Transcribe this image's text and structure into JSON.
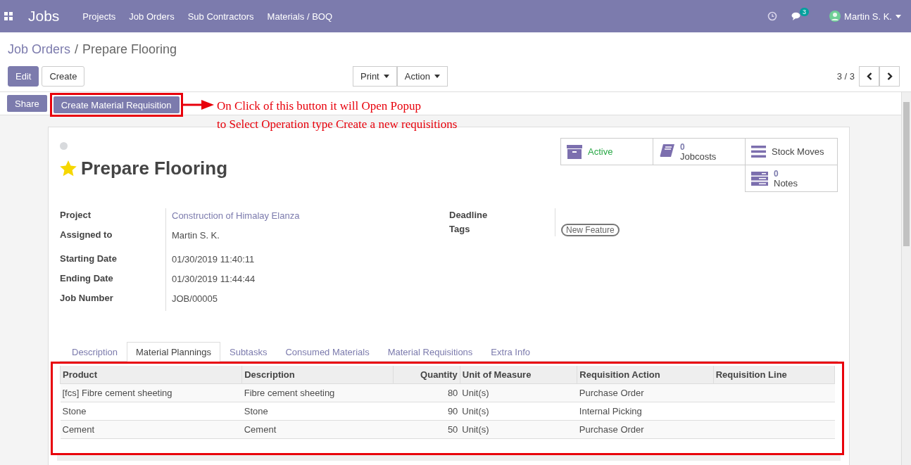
{
  "navbar": {
    "app_title": "Jobs",
    "menu": [
      "Projects",
      "Job Orders",
      "Sub Contractors",
      "Materials / BOQ"
    ],
    "chat_count": "3",
    "user": "Martin S. K."
  },
  "breadcrumb_separator": "/",
  "breadcrumb": [
    {
      "label": "Job Orders",
      "kind": "link"
    },
    {
      "label": "Prepare Flooring",
      "kind": "current"
    }
  ],
  "actions": {
    "primary": "Edit",
    "secondary": "Create",
    "dropdowns": [
      "Print",
      "Action"
    ],
    "pager": "3 / 3"
  },
  "header_buttons": [
    {
      "label": "Share",
      "highlighted": false
    },
    {
      "label": "Create Material Requisition",
      "highlighted": true
    }
  ],
  "annotation": {
    "lines": [
      "On Click of this button it will Open Popup",
      "to Select Operation type Create a new requisitions"
    ]
  },
  "record": {
    "starred": true,
    "title": "Prepare Flooring",
    "smart_buttons": [
      {
        "kind": "archive",
        "label": "Active"
      },
      {
        "kind": "book",
        "count": "0",
        "label": "Jobcosts"
      },
      {
        "kind": "list",
        "label": "Stock Moves"
      },
      {
        "kind": "notes",
        "count": "0",
        "label": "Notes"
      }
    ],
    "left_fields": [
      {
        "label": "Project",
        "value": "Construction of Himalay Elanza",
        "kind": "link"
      },
      {
        "label": "Assigned to",
        "value": "Martin S. K.",
        "kind": "text"
      },
      {
        "label": "Starting Date",
        "value": "01/30/2019 11:40:11",
        "kind": "text"
      },
      {
        "label": "Ending Date",
        "value": "01/30/2019 11:44:44",
        "kind": "text"
      },
      {
        "label": "Job Number",
        "value": "JOB/00005",
        "kind": "text"
      }
    ],
    "right_fields": [
      {
        "label": "Deadline",
        "kind": "text"
      },
      {
        "label": "Tags",
        "value": "New Feature",
        "kind": "tag"
      }
    ]
  },
  "tabs": [
    {
      "label": "Description",
      "selected": false
    },
    {
      "label": "Material Plannings",
      "selected": true
    },
    {
      "label": "Subtasks",
      "selected": false
    },
    {
      "label": "Consumed Materials",
      "selected": false
    },
    {
      "label": "Material Requisitions",
      "selected": false
    },
    {
      "label": "Extra Info",
      "selected": false
    }
  ],
  "table": {
    "columns": [
      "Product",
      "Description",
      "Quantity",
      "Unit of Measure",
      "Requisition Action",
      "Requisition Line"
    ],
    "rows": [
      [
        "[fcs] Fibre cement sheeting",
        "Fibre cement sheeting",
        "80",
        "Unit(s)",
        "Purchase Order",
        ""
      ],
      [
        "Stone",
        "Stone",
        "90",
        "Unit(s)",
        "Internal Picking",
        ""
      ],
      [
        "Cement",
        "Cement",
        "50",
        "Unit(s)",
        "Purchase Order",
        ""
      ]
    ]
  }
}
